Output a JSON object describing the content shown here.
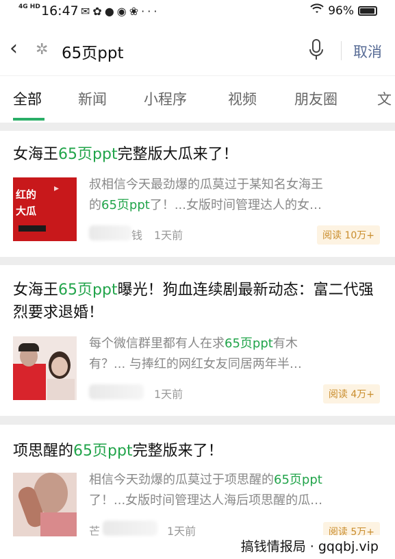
{
  "status_bar": {
    "network": "4G HD",
    "time": "16:47",
    "battery": "96%"
  },
  "search": {
    "query": "65页ppt",
    "cancel_label": "取消"
  },
  "tabs": [
    {
      "label": "全部",
      "active": true
    },
    {
      "label": "新闻"
    },
    {
      "label": "小程序"
    },
    {
      "label": "视频"
    },
    {
      "label": "朋友圈"
    },
    {
      "label": "文"
    }
  ],
  "results": [
    {
      "title_parts": [
        "女海王",
        "65页ppt",
        "完整版大瓜来了！"
      ],
      "snippet_line1": [
        "叔相信今天最劲爆的瓜莫过于某知名女海王"
      ],
      "snippet_line2": [
        "的",
        "65页ppt",
        "了！...女版时间管理达人的女…"
      ],
      "source_visible": "钱",
      "time": "1天前",
      "reads": "阅读 10万+",
      "thumb_text": [
        "红的",
        "大瓜"
      ]
    },
    {
      "title_parts": [
        "女海王",
        "65页ppt",
        "曝光！狗血连续剧最新动态：富二代强烈要求退婚！"
      ],
      "snippet_line1": [
        "每个微信群里都有人在求",
        "65页ppt",
        "有木"
      ],
      "snippet_line2": [
        "有？... 与捧红的网红女友同居两年半…"
      ],
      "source_visible": "",
      "time": "1天前",
      "reads": "阅读 4万+"
    },
    {
      "title_parts": [
        "项思醒的",
        "65页ppt",
        "完整版来了！"
      ],
      "snippet_line1": [
        "相信今天劲爆的瓜莫过于项思醒的",
        "65页ppt"
      ],
      "snippet_line2": [
        "了！...女版时间管理达人海后项思醒的瓜…"
      ],
      "source_visible": "芒",
      "time": "1天前",
      "reads": "阅读 5万+"
    }
  ],
  "watermark": "搞钱情报局 · gqqbj.vip",
  "colors": {
    "highlight": "#21a44a",
    "tab_underline": "#2aae67",
    "cancel": "#576b95",
    "reads_text": "#c98c2b"
  }
}
